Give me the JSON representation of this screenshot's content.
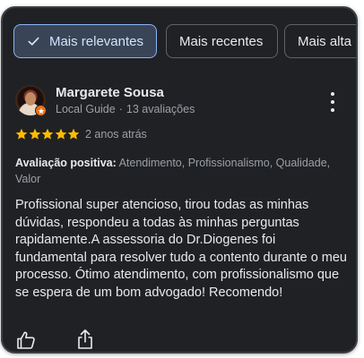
{
  "filters": [
    {
      "label": "Mais relevantes",
      "selected": true
    },
    {
      "label": "Mais recentes",
      "selected": false
    },
    {
      "label": "Mais alta",
      "selected": false
    }
  ],
  "review": {
    "author_name": "Margarete Sousa",
    "author_level": "Local Guide",
    "separator": "·",
    "review_count": "13 avaliações",
    "rating": 5,
    "max_rating": 5,
    "date": "2 anos atrás",
    "positive_label": "Avaliação positiva:",
    "positive_tags": "Atendimento, Profissionalismo, Qualidade, Valor",
    "text": "Profissional super atencioso, tirou todas as minhas dúvidas, respondeu a todas às minhas perguntas rapidamente.A assessoria do Dr.Diogenes foi fundamental para resolver tudo a contento durante o meu processo. Ótimo atendimento, com profissionalismo que se espera de um bom advogado! Recomendo!"
  },
  "icons": {
    "check": "check-icon",
    "more": "more-vertical-icon",
    "star": "star-icon",
    "like": "thumbs-up-icon",
    "share": "share-icon",
    "guide_badge": "local-guide-badge-icon"
  },
  "colors": {
    "card_bg": "#202124",
    "chip_selected_bg": "#394457",
    "chip_selected_border": "#8ab4f8",
    "star": "#fbbc04",
    "text_primary": "#e8eaed",
    "text_secondary": "#9aa0a6",
    "badge": "#e8711a"
  }
}
